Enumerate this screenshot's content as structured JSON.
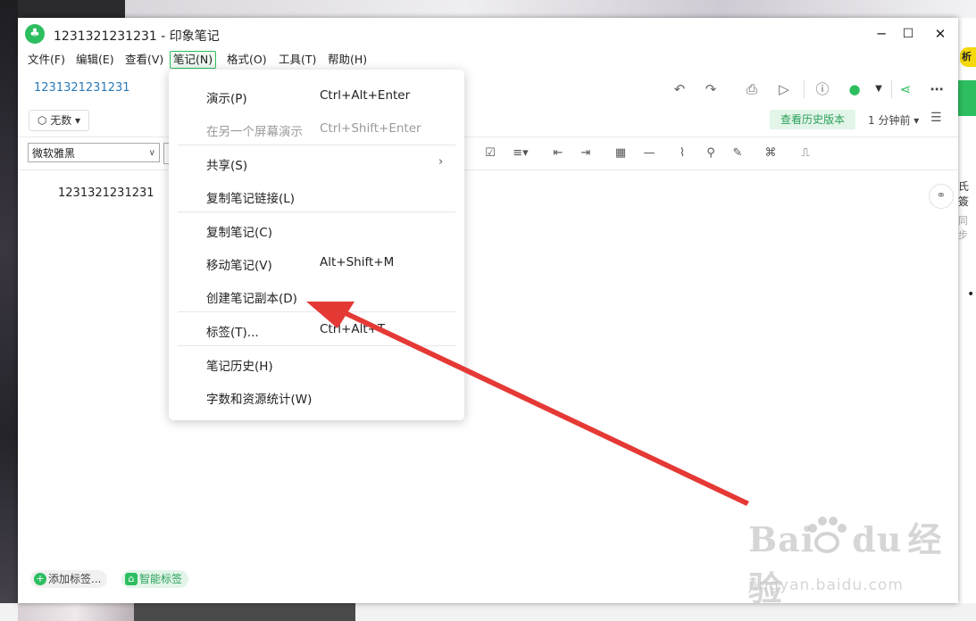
{
  "window": {
    "title": "1231321231231 - 印象笔记",
    "controls": {
      "minimize": "─",
      "maximize": "☐",
      "close": "✕"
    }
  },
  "menubar": {
    "items": [
      "文件(F)",
      "编辑(E)",
      "查看(V)",
      "笔记(N)",
      "格式(O)",
      "工具(T)",
      "帮助(H)"
    ],
    "active": "笔记(N)"
  },
  "header": {
    "notebook": "1231321231231",
    "tag_button": "无数",
    "history_button": "查看历史版本",
    "time_label": "1 分钟前",
    "icons": [
      "undo-icon",
      "redo-icon",
      "print-icon",
      "present-icon",
      "info-icon",
      "share-user-icon",
      "chevron-down-icon",
      "share-icon",
      "more-icon"
    ]
  },
  "format_bar": {
    "font": "微软雅黑",
    "icons": [
      "checkbox-icon",
      "align-icon",
      "outdent-icon",
      "indent-icon",
      "table-icon",
      "hr-icon",
      "attach-icon",
      "link-icon",
      "draw-icon",
      "code-icon",
      "stamp-icon"
    ]
  },
  "note": {
    "title": "1231321231231"
  },
  "footer": {
    "add_tag": "添加标签...",
    "smart_tag": "智能标签"
  },
  "dropdown": {
    "items": [
      {
        "label": "演示(P)",
        "shortcut": "Ctrl+Alt+Enter",
        "disabled": false
      },
      {
        "label": "在另一个屏幕演示",
        "shortcut": "Ctrl+Shift+Enter",
        "disabled": true
      },
      {
        "label": "共享(S)",
        "submenu": true
      },
      {
        "label": "复制笔记链接(L)"
      },
      {
        "label": "复制笔记(C)"
      },
      {
        "label": "移动笔记(V)",
        "shortcut": "Alt+Shift+M"
      },
      {
        "label": "创建笔记副本(D)"
      },
      {
        "label": "标签(T)...",
        "shortcut": "Ctrl+Alt+T"
      },
      {
        "label": "笔记历史(H)"
      },
      {
        "label": "字数和资源统计(W)"
      }
    ]
  },
  "right_window": {
    "badge": "析",
    "text1": "氏簽",
    "text2": "同步"
  },
  "watermark": {
    "brand": "Bai",
    "brand2": "du",
    "cn": "经验",
    "url": "jingyan.baidu.com"
  },
  "annotation_color": "#e53935",
  "accent_color": "#2dbe60"
}
